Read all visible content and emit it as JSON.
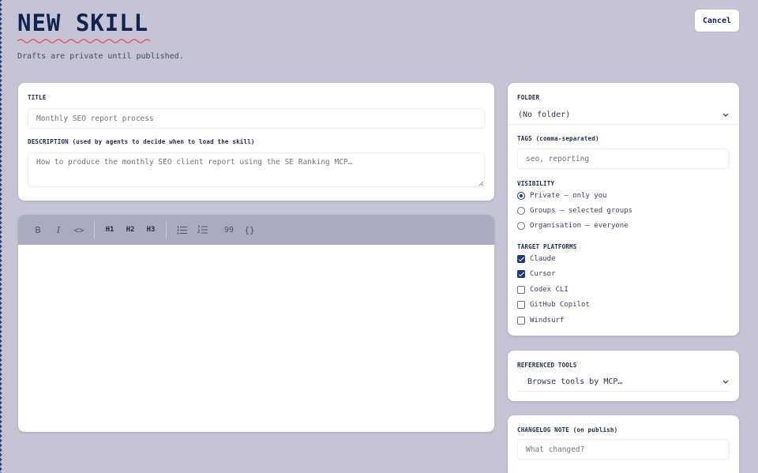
{
  "header": {
    "title": "NEW SKILL",
    "subtitle": "Drafts are private until published.",
    "cancel_label": "Cancel"
  },
  "main": {
    "title_label": "TITLE",
    "title_placeholder": "Monthly SEO report process",
    "description_label": "DESCRIPTION",
    "description_hint": "(used by agents to decide when to load the skill)",
    "description_placeholder": "How to produce the monthly SEO client report using the SE Ranking MCP…",
    "toolbar": {
      "bold": "B",
      "italic": "I",
      "code": "<>",
      "h1": "H1",
      "h2": "H2",
      "h3": "H3",
      "quote": "99",
      "code_block": "{}"
    }
  },
  "sidebar": {
    "folder_label": "FOLDER",
    "folder_value": "(No folder)",
    "tags_label": "TAGS",
    "tags_hint": "(comma-separated)",
    "tags_placeholder": "seo, reporting",
    "visibility_label": "VISIBILITY",
    "visibility_options": [
      {
        "label": "Private — only you",
        "selected": true
      },
      {
        "label": "Groups — selected groups",
        "selected": false
      },
      {
        "label": "Organisation — everyone",
        "selected": false
      }
    ],
    "platforms_label": "TARGET PLATFORMS",
    "platforms": [
      {
        "label": "Claude",
        "checked": true
      },
      {
        "label": "Cursor",
        "checked": true
      },
      {
        "label": "Codex CLI",
        "checked": false
      },
      {
        "label": "GitHub Copilot",
        "checked": false
      },
      {
        "label": "Windsurf",
        "checked": false
      }
    ],
    "tools_label": "REFERENCED TOOLS",
    "tools_value": "Browse tools by MCP…",
    "changelog_label": "CHANGELOG NOTE",
    "changelog_hint": "(on publish)",
    "changelog_placeholder": "What changed?"
  },
  "colors": {
    "background": "#c4c4d4",
    "accent": "#0f2350",
    "squiggle": "#e0605e"
  }
}
